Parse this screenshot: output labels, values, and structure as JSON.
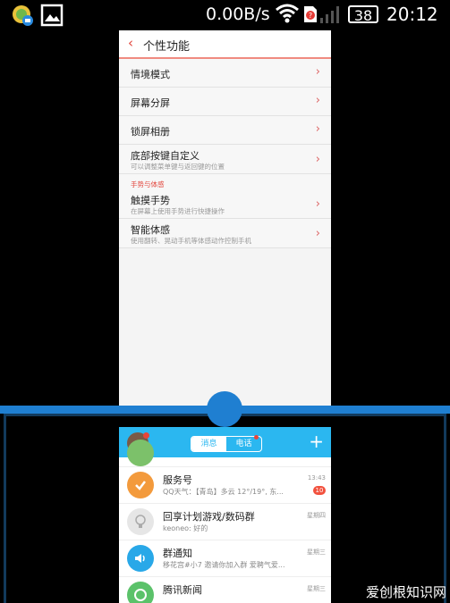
{
  "status_bar": {
    "speed": "0.00B/s",
    "battery": "38",
    "time": "20:12",
    "icons": [
      "app-notification-icon",
      "gallery-icon",
      "wifi-icon",
      "sim-alert-icon",
      "signal-icon"
    ]
  },
  "settings": {
    "back_icon": "‹",
    "title": "个性功能",
    "items": [
      {
        "label": "情境模式"
      },
      {
        "label": "屏幕分屏"
      },
      {
        "label": "锁屏相册"
      },
      {
        "label": "底部按键自定义",
        "sub": "可以调整菜单键与返回键的位置"
      }
    ],
    "section_label": "手势与体感",
    "section_items": [
      {
        "label": "触摸手势",
        "sub": "在屏幕上使用手势进行快捷操作"
      },
      {
        "label": "智能体感",
        "sub": "使用翻转、晃动手机等体感动作控制手机"
      }
    ],
    "chevron": "›"
  },
  "qq": {
    "tabs": [
      "消息",
      "电话"
    ],
    "plus": "+",
    "chats": [
      {
        "name": "服务号",
        "preview": "QQ天气：【青岛】多云 12°/19°, 东...",
        "time": "13:43",
        "badge": "10",
        "color": "#f39a3c"
      },
      {
        "name": "回享计划游戏/数码群",
        "preview": "keoneo: 好的",
        "time": "星期四",
        "color": "#e6e6e6"
      },
      {
        "name": "群通知",
        "preview": "移花宫#小7 邀请你加入群 爱聘气爱...",
        "time": "星期三",
        "color": "#29a8e8"
      },
      {
        "name": "腾讯新闻",
        "preview": "",
        "time": "星期三",
        "color": "#5bc26a"
      }
    ]
  },
  "watermark": "爱创根知识网"
}
